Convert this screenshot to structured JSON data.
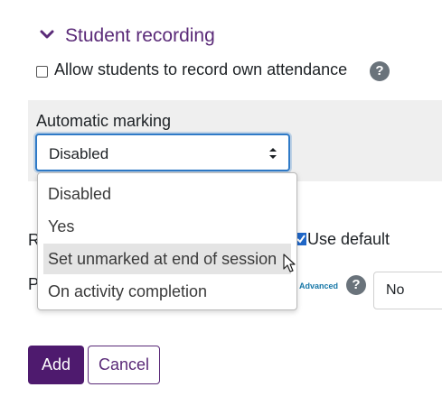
{
  "section": {
    "title": "Student recording"
  },
  "allow_record": {
    "label": "Allow students to record own attendance",
    "help_icon": "?"
  },
  "automatic_marking": {
    "label": "Automatic marking",
    "selected": "Disabled",
    "options": [
      "Disabled",
      "Yes",
      "Set unmarked at end of session",
      "On activity completion"
    ],
    "highlighted_index": 2
  },
  "row_r": {
    "label_initial": "R",
    "use_default_label": "Use default"
  },
  "row_p": {
    "label_initial": "P",
    "advanced_label": "Advanced",
    "help_icon": "?",
    "select_value": "No"
  },
  "buttons": {
    "add": "Add",
    "cancel": "Cancel"
  },
  "colors": {
    "brand": "#4e1a6e",
    "title": "#5a2a78",
    "focus": "#2f7ac7"
  }
}
